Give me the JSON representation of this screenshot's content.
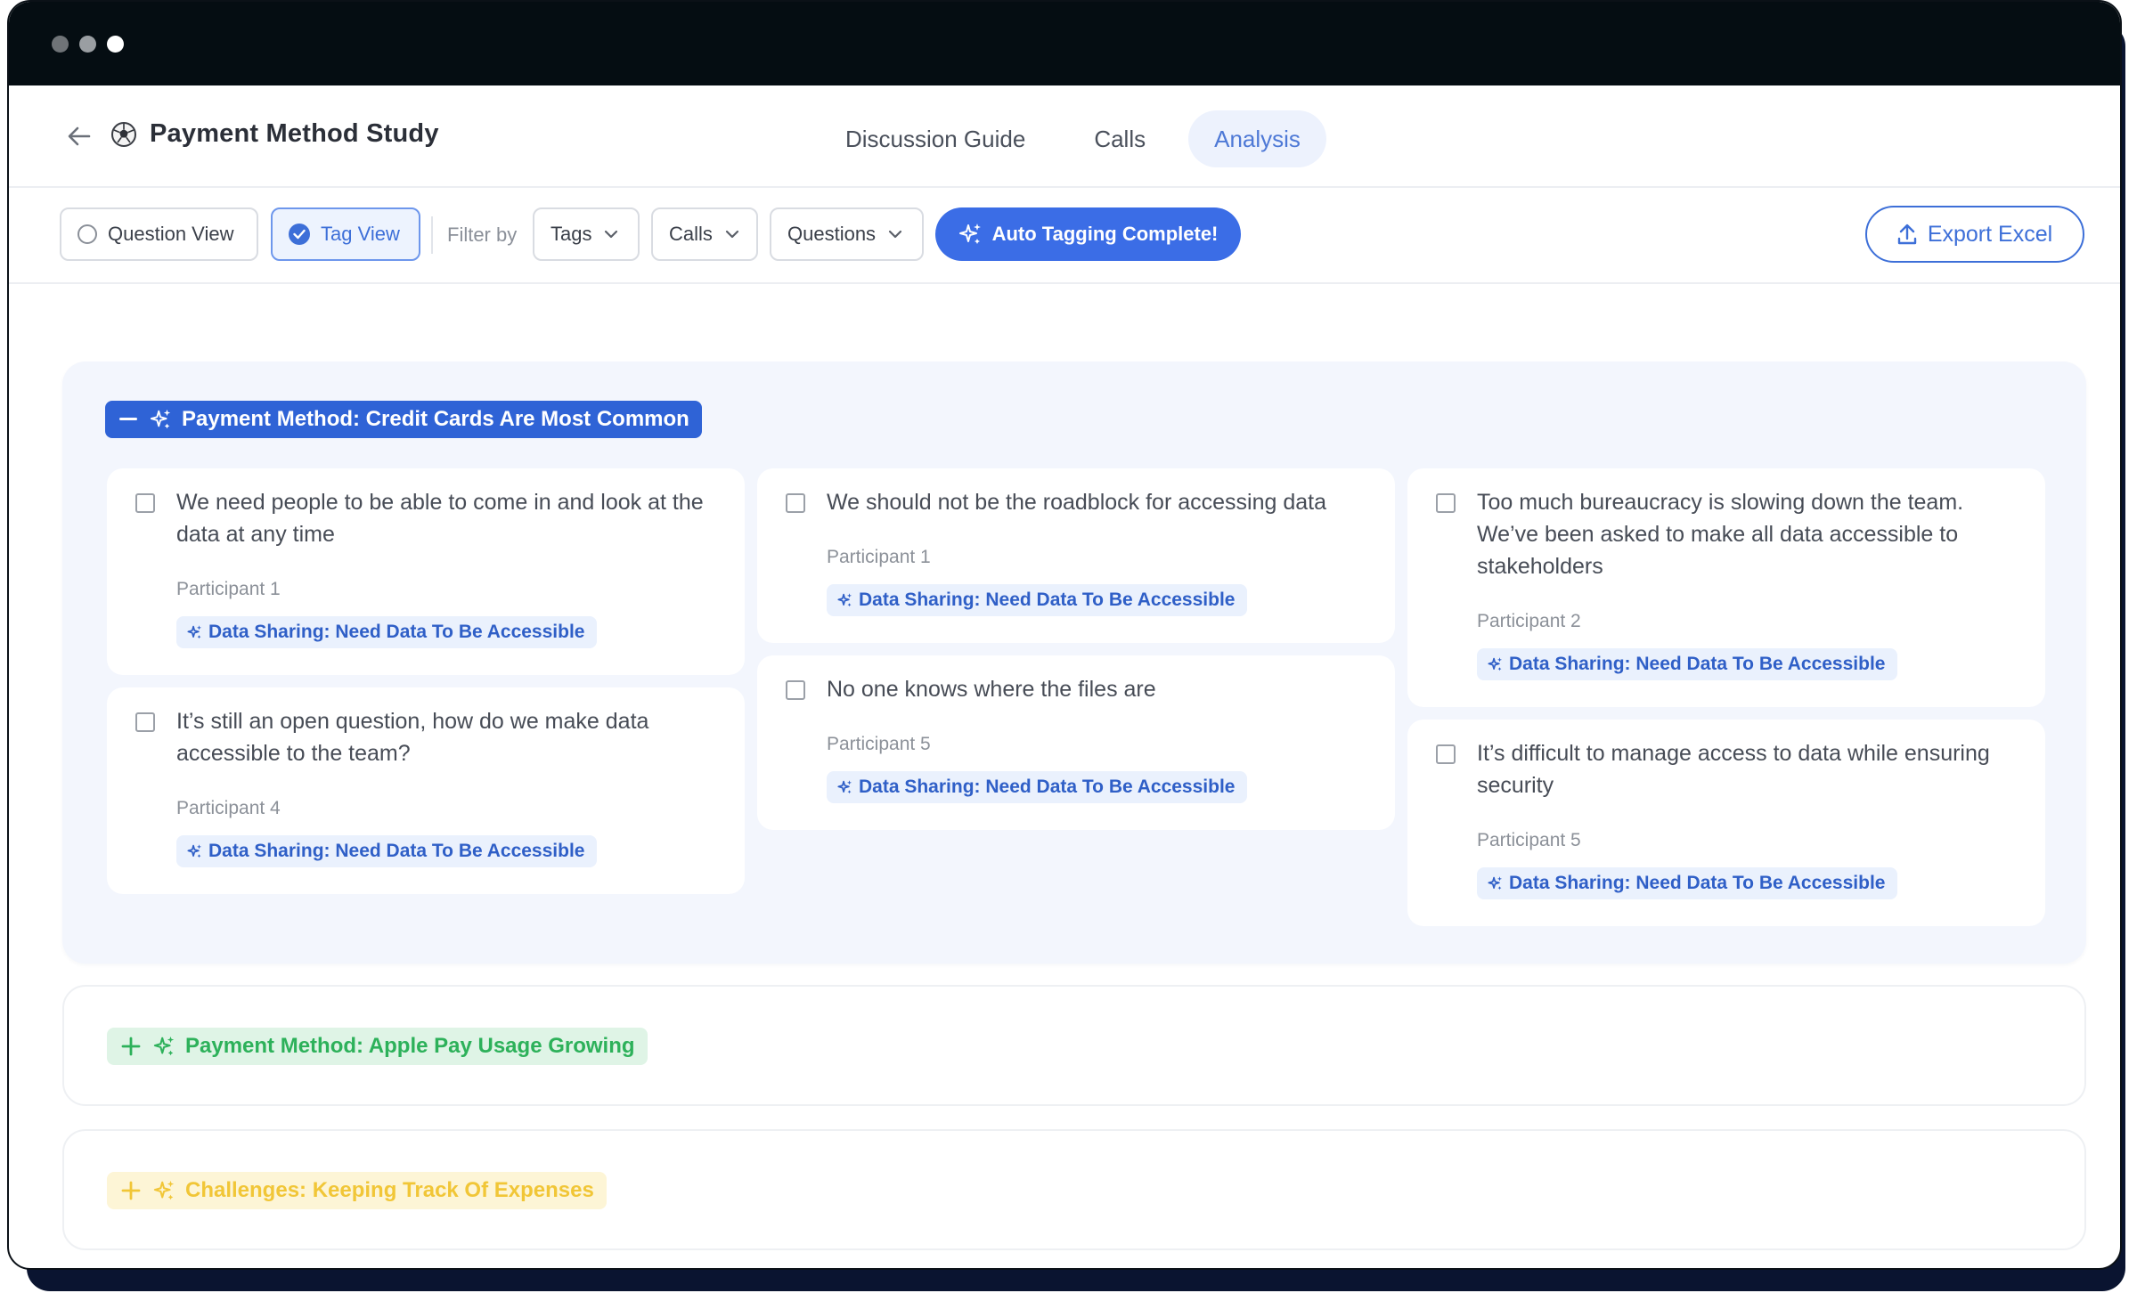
{
  "window": {
    "controls": [
      "close",
      "minimize",
      "maximize"
    ]
  },
  "header": {
    "back_icon": "arrow-left-icon",
    "study_icon": "ball-icon",
    "title": "Payment Method Study",
    "tabs": [
      {
        "label": "Discussion Guide",
        "active": false
      },
      {
        "label": "Calls",
        "active": false
      },
      {
        "label": "Analysis",
        "active": true
      }
    ]
  },
  "toolbar": {
    "question_view": "Question View",
    "tag_view": "Tag View",
    "selected_view": "Tag View",
    "filter_label": "Filter by",
    "filters": [
      "Tags",
      "Calls",
      "Questions"
    ],
    "auto_tagging": "Auto Tagging Complete!",
    "export": "Export Excel"
  },
  "colors": {
    "primary": "#3b6de6",
    "group1_bg": "#f3f6fd",
    "chip_bg": "#eaf1fd",
    "chip_text": "#2f5fc7",
    "green": "#2db15a",
    "green_bg": "#dff4e6",
    "yellow": "#f1c637",
    "yellow_bg": "#fdf5d6"
  },
  "groups": [
    {
      "title": "Payment Method: Credit Cards Are Most Common",
      "expanded": true,
      "cards": [
        {
          "quote": "We need people to be able to come in and look at the data at any time",
          "participant": "Participant 1",
          "tag": "Data Sharing: Need Data To Be Accessible"
        },
        {
          "quote": "It’s still an open question, how do we make data accessible to the team?",
          "participant": "Participant 4",
          "tag": "Data Sharing: Need Data To Be Accessible"
        },
        {
          "quote": "We should not be the roadblock for accessing data",
          "participant": "Participant 1",
          "tag": "Data Sharing: Need Data To Be Accessible"
        },
        {
          "quote": "No one knows where the files are",
          "participant": "Participant 5",
          "tag": "Data Sharing: Need Data To Be Accessible"
        },
        {
          "quote": "Too much bureaucracy is slowing down the team. We’ve been asked to make all data accessible to stakeholders",
          "participant": "Participant 2",
          "tag": "Data Sharing: Need Data To Be Accessible"
        },
        {
          "quote": "It’s difficult to manage access to data while ensuring security",
          "participant": "Participant 5",
          "tag": "Data Sharing: Need Data To Be Accessible"
        }
      ]
    },
    {
      "title": "Payment Method: Apple Pay Usage Growing",
      "expanded": false
    },
    {
      "title": "Challenges: Keeping Track Of Expenses",
      "expanded": false
    }
  ]
}
